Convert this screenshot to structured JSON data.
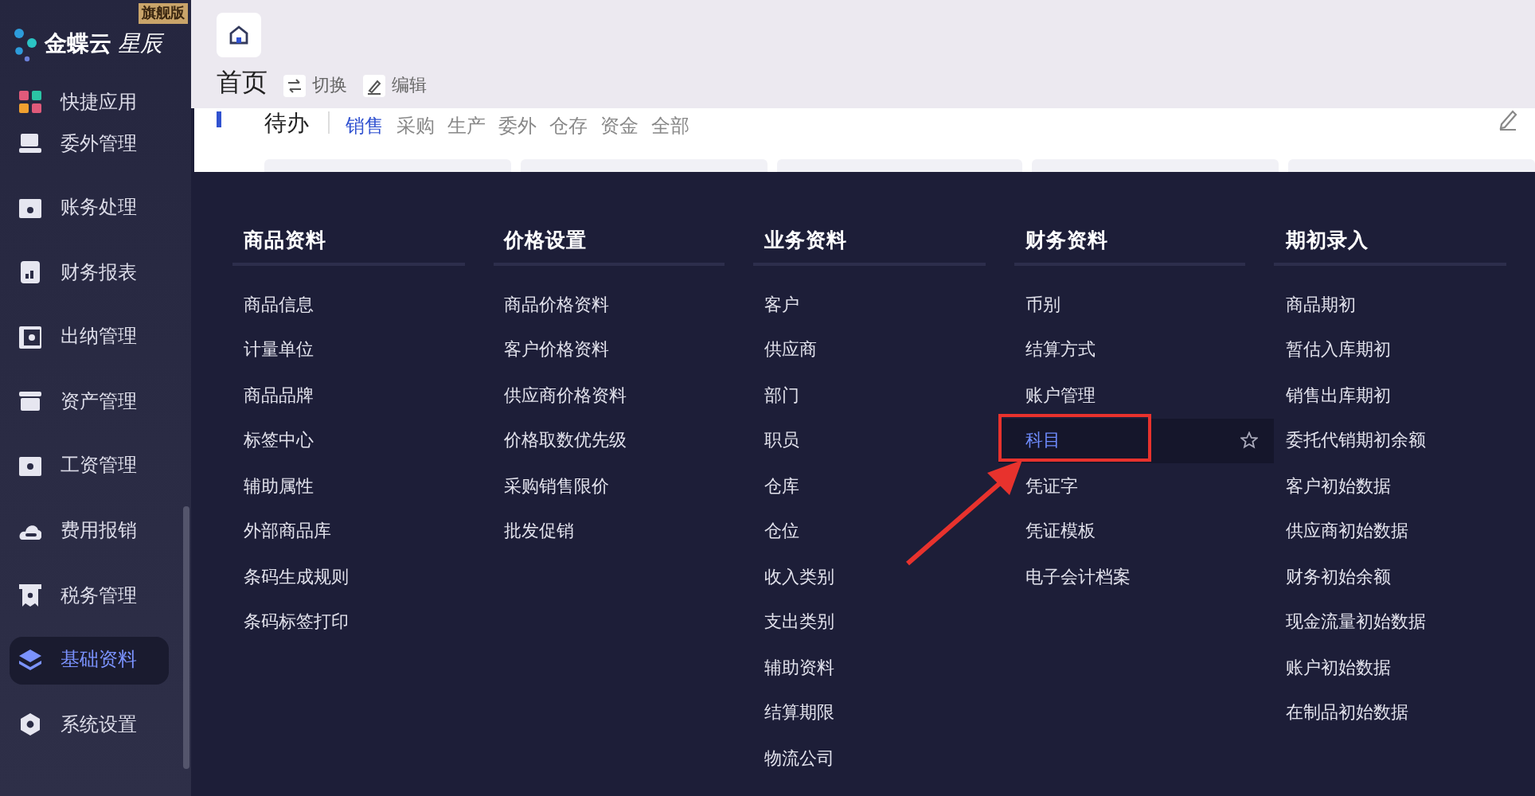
{
  "logo": {
    "brand": "金蝶云",
    "product": "星辰",
    "badge": "旗舰版"
  },
  "sidebar": {
    "items": [
      {
        "label": "快捷应用",
        "selected": false
      },
      {
        "label": "委外管理",
        "selected": false
      },
      {
        "label": "账务处理",
        "selected": false
      },
      {
        "label": "财务报表",
        "selected": false
      },
      {
        "label": "出纳管理",
        "selected": false
      },
      {
        "label": "资产管理",
        "selected": false
      },
      {
        "label": "工资管理",
        "selected": false
      },
      {
        "label": "费用报销",
        "selected": false
      },
      {
        "label": "税务管理",
        "selected": false
      },
      {
        "label": "基础资料",
        "selected": true
      },
      {
        "label": "系统设置",
        "selected": false
      }
    ]
  },
  "page": {
    "title": "首页",
    "actions": [
      "切换",
      "编辑"
    ]
  },
  "todo": {
    "title": "待办",
    "tabs": [
      {
        "label": "销售",
        "selected": true
      },
      {
        "label": "采购",
        "selected": false
      },
      {
        "label": "生产",
        "selected": false
      },
      {
        "label": "委外",
        "selected": false
      },
      {
        "label": "仓存",
        "selected": false
      },
      {
        "label": "资金",
        "selected": false
      },
      {
        "label": "全部",
        "selected": false
      }
    ]
  },
  "menu": {
    "columns": [
      {
        "title": "商品资料",
        "items": [
          {
            "label": "商品信息"
          },
          {
            "label": "计量单位"
          },
          {
            "label": "商品品牌"
          },
          {
            "label": "标签中心"
          },
          {
            "label": "辅助属性"
          },
          {
            "label": "外部商品库"
          },
          {
            "label": "条码生成规则"
          },
          {
            "label": "条码标签打印"
          }
        ]
      },
      {
        "title": "价格设置",
        "items": [
          {
            "label": "商品价格资料"
          },
          {
            "label": "客户价格资料"
          },
          {
            "label": "供应商价格资料"
          },
          {
            "label": "价格取数优先级"
          },
          {
            "label": "采购销售限价"
          },
          {
            "label": "批发促销"
          }
        ]
      },
      {
        "title": "业务资料",
        "items": [
          {
            "label": "客户"
          },
          {
            "label": "供应商"
          },
          {
            "label": "部门"
          },
          {
            "label": "职员"
          },
          {
            "label": "仓库"
          },
          {
            "label": "仓位"
          },
          {
            "label": "收入类别"
          },
          {
            "label": "支出类别"
          },
          {
            "label": "辅助资料"
          },
          {
            "label": "结算期限"
          },
          {
            "label": "物流公司"
          }
        ]
      },
      {
        "title": "财务资料",
        "items": [
          {
            "label": "币别"
          },
          {
            "label": "结算方式"
          },
          {
            "label": "账户管理"
          },
          {
            "label": "科目",
            "hovered": true,
            "annotated": true
          },
          {
            "label": "凭证字"
          },
          {
            "label": "凭证模板"
          },
          {
            "label": "电子会计档案"
          }
        ]
      },
      {
        "title": "期初录入",
        "items": [
          {
            "label": "商品期初"
          },
          {
            "label": "暂估入库期初"
          },
          {
            "label": "销售出库期初"
          },
          {
            "label": "委托代销期初余额"
          },
          {
            "label": "客户初始数据"
          },
          {
            "label": "供应商初始数据"
          },
          {
            "label": "财务初始余额"
          },
          {
            "label": "现金流量初始数据"
          },
          {
            "label": "账户初始数据"
          },
          {
            "label": "在制品初始数据"
          }
        ]
      }
    ]
  }
}
